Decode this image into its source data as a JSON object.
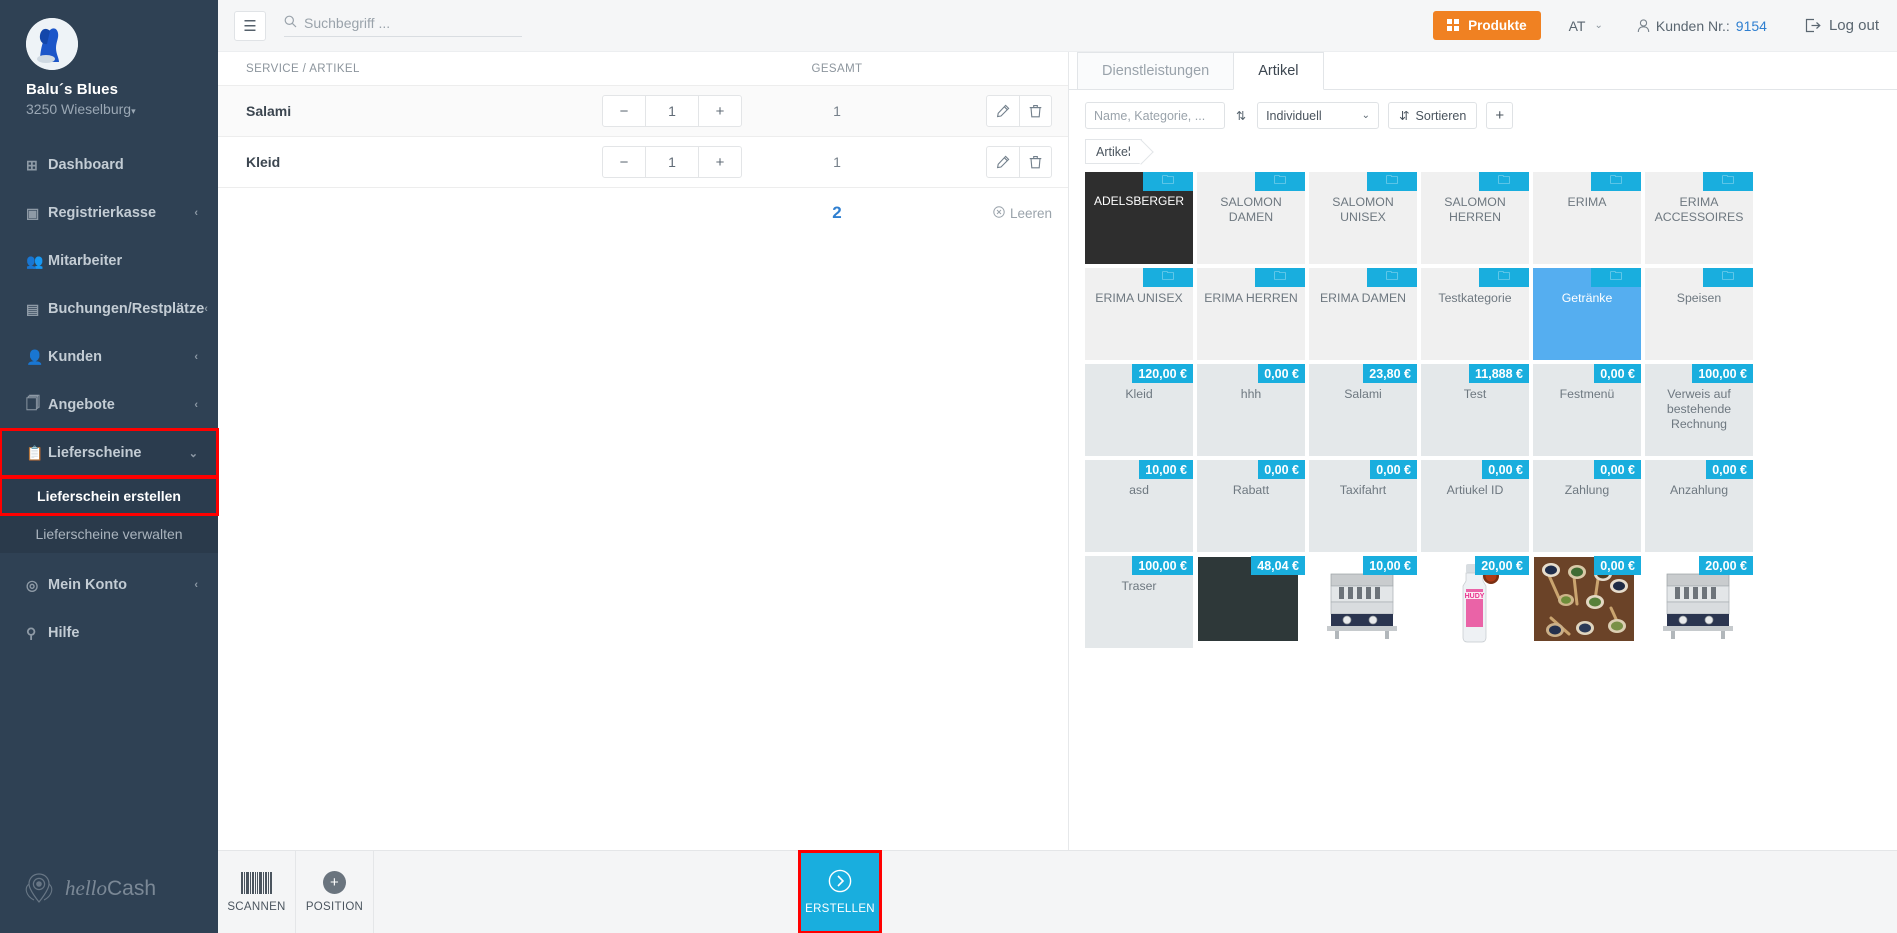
{
  "sidebar": {
    "brand": {
      "name": "Balu´s Blues",
      "city": "3250 Wieselburg",
      "caret": "▾",
      "avatar_icon": "dog-avatar"
    },
    "items": [
      {
        "label": "Dashboard",
        "icon": "dashboard-icon",
        "glyph": "⊞",
        "chevron": ""
      },
      {
        "label": "Registrierkasse",
        "icon": "cash-register-icon",
        "glyph": "▣",
        "chevron": "‹"
      },
      {
        "label": "Mitarbeiter",
        "icon": "employees-icon",
        "glyph": "👥",
        "chevron": ""
      },
      {
        "label": "Buchungen/Restplätze",
        "icon": "calendar-icon",
        "glyph": "▤",
        "chevron": "‹"
      },
      {
        "label": "Kunden",
        "icon": "customers-icon",
        "glyph": "👤",
        "chevron": "‹"
      },
      {
        "label": "Angebote",
        "icon": "briefcase-icon",
        "glyph": "🗍",
        "chevron": "‹"
      },
      {
        "label": "Lieferscheine",
        "icon": "clipboard-icon",
        "glyph": "📋",
        "chevron": "⌄"
      }
    ],
    "submenu": [
      {
        "label": "Lieferschein erstellen"
      },
      {
        "label": "Lieferscheine verwalten"
      }
    ],
    "items_after": [
      {
        "label": "Mein Konto",
        "icon": "account-icon",
        "glyph": "◎",
        "chevron": "‹"
      },
      {
        "label": "Hilfe",
        "icon": "help-icon",
        "glyph": "⚲",
        "chevron": ""
      }
    ],
    "logo": {
      "hello": "hello",
      "cash": "Cash"
    }
  },
  "topbar": {
    "menu_icon": "hamburger-icon",
    "menu_glyph": "☰",
    "search_placeholder": "Suchbegriff ...",
    "search_icon": "search-icon",
    "produkte_label": "Produkte",
    "lang": "AT",
    "lang_chevron": "⌄",
    "kunden_label": "Kunden Nr.:",
    "kunden_number": "9154",
    "logout_label": "Log out",
    "logout_glyph": "⇥",
    "accent_orange": "#f08122"
  },
  "cart": {
    "col_name": "SERVICE / ARTIKEL",
    "col_total": "GESAMT",
    "rows": [
      {
        "name": "Salami",
        "qty": "1",
        "total": "1"
      },
      {
        "name": "Kleid",
        "qty": "1",
        "total": "1"
      }
    ],
    "minus": "−",
    "plus": "+",
    "edit_glyph": "✎",
    "delete_glyph": "🗑",
    "sum_total": "2",
    "clear_label": "Leeren",
    "clear_glyph": "⊗"
  },
  "products": {
    "tabs": [
      {
        "label": "Dienstleistungen",
        "active": false
      },
      {
        "label": "Artikel",
        "active": true
      }
    ],
    "search_placeholder": "Name, Kategorie, ...",
    "sort_toggle_glyph": "⇅",
    "select_value": "Individuell",
    "select_chevron": "⌄",
    "sort_label": "Sortieren",
    "sort_glyph": "⇵",
    "add_label": "+",
    "breadcrumb": "Artikel",
    "badge_color": "#19aede",
    "tiles": [
      {
        "name": "ADELSBERGER",
        "type": "folder",
        "badge": "folder",
        "style": "cat-dark"
      },
      {
        "name": "SALOMON DAMEN",
        "type": "folder",
        "badge": "folder",
        "style": "cat"
      },
      {
        "name": "SALOMON UNISEX",
        "type": "folder",
        "badge": "folder",
        "style": "cat"
      },
      {
        "name": "SALOMON HERREN",
        "type": "folder",
        "badge": "folder",
        "style": "cat"
      },
      {
        "name": "ERIMA",
        "type": "folder",
        "badge": "folder",
        "style": "cat"
      },
      {
        "name": "ERIMA ACCESSOIRES",
        "type": "folder",
        "badge": "folder",
        "style": "cat"
      },
      {
        "name": "ERIMA UNISEX",
        "type": "folder",
        "badge": "folder",
        "style": "cat"
      },
      {
        "name": "ERIMA HERREN",
        "type": "folder",
        "badge": "folder",
        "style": "cat"
      },
      {
        "name": "ERIMA DAMEN",
        "type": "folder",
        "badge": "folder",
        "style": "cat"
      },
      {
        "name": "Testkategorie",
        "type": "folder",
        "badge": "folder",
        "style": "cat"
      },
      {
        "name": "Getränke",
        "type": "folder",
        "badge": "folder",
        "style": "cat-blue"
      },
      {
        "name": "Speisen",
        "type": "folder",
        "badge": "folder",
        "style": "cat"
      },
      {
        "name": "Kleid",
        "type": "article",
        "badge": "120,00 €",
        "style": "art"
      },
      {
        "name": "hhh",
        "type": "article",
        "badge": "0,00 €",
        "style": "art"
      },
      {
        "name": "Salami",
        "type": "article",
        "badge": "23,80 €",
        "style": "art"
      },
      {
        "name": "Test",
        "type": "article",
        "badge": "11,888 €",
        "style": "art"
      },
      {
        "name": "Festmenü",
        "type": "article",
        "badge": "0,00 €",
        "style": "art"
      },
      {
        "name": "Verweis auf bestehende Rechnung",
        "type": "article",
        "badge": "100,00 €",
        "style": "art"
      },
      {
        "name": "asd",
        "type": "article",
        "badge": "10,00 €",
        "style": "art"
      },
      {
        "name": "Rabatt",
        "type": "article",
        "badge": "0,00 €",
        "style": "art"
      },
      {
        "name": "Taxifahrt",
        "type": "article",
        "badge": "0,00 €",
        "style": "art"
      },
      {
        "name": "Artiukel ID",
        "type": "article",
        "badge": "0,00 €",
        "style": "art"
      },
      {
        "name": "Zahlung",
        "type": "article",
        "badge": "0,00 €",
        "style": "art"
      },
      {
        "name": "Anzahlung",
        "type": "article",
        "badge": "0,00 €",
        "style": "art"
      },
      {
        "name": "Traser",
        "type": "article",
        "badge": "100,00 €",
        "style": "art"
      },
      {
        "name": "",
        "type": "image",
        "badge": "48,04 €",
        "style": "img",
        "photo": "dark-fabric"
      },
      {
        "name": "",
        "type": "image",
        "badge": "10,00 €",
        "style": "img",
        "photo": "toaster"
      },
      {
        "name": "",
        "type": "image",
        "badge": "20,00 €",
        "style": "img",
        "photo": "spray-bottle"
      },
      {
        "name": "",
        "type": "image",
        "badge": "0,00 €",
        "style": "img",
        "photo": "spices-spoons"
      },
      {
        "name": "",
        "type": "image",
        "badge": "20,00 €",
        "style": "img",
        "photo": "toaster"
      }
    ]
  },
  "bottombar": {
    "scan_label": "SCANNEN",
    "scan_icon": "barcode-icon",
    "position_label": "POSITION",
    "position_icon": "plus-circle-icon",
    "create_label": "ERSTELLEN",
    "create_icon": "arrow-right-circle-icon",
    "create_color": "#19aede",
    "highlight_color": "#ff0000"
  }
}
